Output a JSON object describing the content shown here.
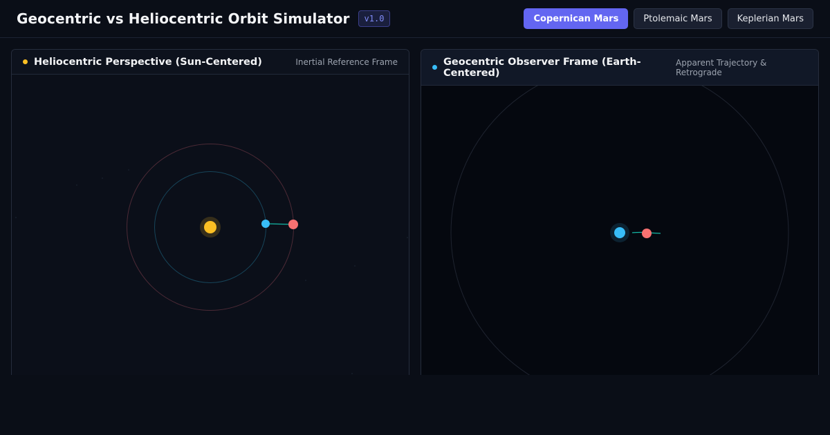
{
  "header": {
    "title": "Geocentric vs Heliocentric Orbit Simulator",
    "version": "v1.0",
    "modes": [
      {
        "label": "Copernican Mars",
        "active": true
      },
      {
        "label": "Ptolemaic Mars",
        "active": false
      },
      {
        "label": "Keplerian Mars",
        "active": false
      }
    ]
  },
  "left_panel": {
    "title": "Heliocentric Perspective (Sun-Centered)",
    "subtitle": "Inertial Reference Frame",
    "dot_color": "#fbbf24"
  },
  "right_panel": {
    "title": "Geocentric Observer Frame (Earth-Centered)",
    "subtitle": "Apparent Trajectory & Retrograde",
    "dot_color": "#38bdf8"
  },
  "colors": {
    "accent": "#6366f1",
    "sun": "#fbbf24",
    "earth": "#38bdf8",
    "mars": "#f87171",
    "sightline": "#14b8a6"
  }
}
